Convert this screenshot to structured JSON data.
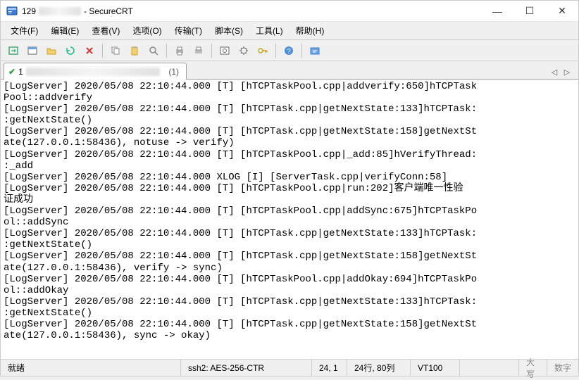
{
  "window": {
    "title_prefix": "129",
    "title_suffix": " - SecureCRT",
    "minimize": "—",
    "maximize": "☐",
    "close": "✕"
  },
  "menu": {
    "file": "文件(F)",
    "edit": "编辑(E)",
    "view": "查看(V)",
    "options": "选项(O)",
    "transfer": "传输(T)",
    "script": "脚本(S)",
    "tools": "工具(L)",
    "help": "帮助(H)"
  },
  "tab": {
    "prefix": "1",
    "suffix": "(1)"
  },
  "terminal_lines": [
    "[LogServer] 2020/05/08 22:10:44.000 [T] [hTCPTaskPool.cpp|addverify:650]hTCPTask",
    "Pool::addverify",
    "[LogServer] 2020/05/08 22:10:44.000 [T] [hTCPTask.cpp|getNextState:133]hTCPTask:",
    ":getNextState()",
    "[LogServer] 2020/05/08 22:10:44.000 [T] [hTCPTask.cpp|getNextState:158]getNextSt",
    "ate(127.0.0.1:58436), notuse -> verify)",
    "[LogServer] 2020/05/08 22:10:44.000 [T] [hTCPTaskPool.cpp|_add:85]hVerifyThread:",
    ":_add",
    "[LogServer] 2020/05/08 22:10:44.000 XLOG [I] [ServerTask.cpp|verifyConn:58]",
    "[LogServer] 2020/05/08 22:10:44.000 [T] [hTCPTaskPool.cpp|run:202]客户端唯一性验",
    "证成功",
    "[LogServer] 2020/05/08 22:10:44.000 [T] [hTCPTaskPool.cpp|addSync:675]hTCPTaskPo",
    "ol::addSync",
    "[LogServer] 2020/05/08 22:10:44.000 [T] [hTCPTask.cpp|getNextState:133]hTCPTask:",
    ":getNextState()",
    "[LogServer] 2020/05/08 22:10:44.000 [T] [hTCPTask.cpp|getNextState:158]getNextSt",
    "ate(127.0.0.1:58436), verify -> sync)",
    "[LogServer] 2020/05/08 22:10:44.000 [T] [hTCPTaskPool.cpp|addOkay:694]hTCPTaskPo",
    "ol::addOkay",
    "[LogServer] 2020/05/08 22:10:44.000 [T] [hTCPTask.cpp|getNextState:133]hTCPTask:",
    ":getNextState()",
    "[LogServer] 2020/05/08 22:10:44.000 [T] [hTCPTask.cpp|getNextState:158]getNextSt",
    "ate(127.0.0.1:58436), sync -> okay)"
  ],
  "status": {
    "ready": "就绪",
    "encryption": "ssh2: AES-256-CTR",
    "cursor": "24,  1",
    "size": "24行, 80列",
    "term": "VT100",
    "caps": "大写",
    "num": "数字"
  },
  "icons": {
    "app": "app-icon"
  }
}
